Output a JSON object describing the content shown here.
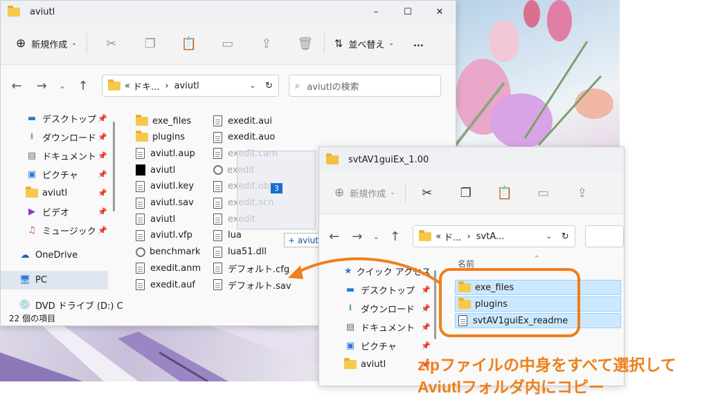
{
  "win1": {
    "title": "aviutl",
    "toolbar": {
      "new_label": "新規作成",
      "sort_label": "並べ替え",
      "more": "..."
    },
    "path": {
      "prefix": "«",
      "part1": "ドキ...",
      "sep": "›",
      "part2": "aviutl"
    },
    "search_placeholder": "aviutlの検索",
    "sidebar": [
      {
        "label": "デスクトップ",
        "icon": "desktop-icon"
      },
      {
        "label": "ダウンロード",
        "icon": "download-icon"
      },
      {
        "label": "ドキュメント",
        "icon": "document-icon"
      },
      {
        "label": "ピクチャ",
        "icon": "picture-icon"
      },
      {
        "label": "aviutl",
        "icon": "folder-icon"
      },
      {
        "label": "ビデオ",
        "icon": "video-icon"
      },
      {
        "label": "ミュージック",
        "icon": "music-icon"
      }
    ],
    "onedrive": "OneDrive",
    "pc": "PC",
    "dvd": "DVD ドライブ (D:) C",
    "status": "22 個の項目",
    "files_col1": [
      "exe_files",
      "plugins",
      "aviutl.aup",
      "aviutl",
      "aviutl.key",
      "aviutl.sav",
      "aviutl",
      "aviutl.vfp",
      "benchmark",
      "exedit.anm",
      "exedit.auf"
    ],
    "files_col2": [
      "exedit.aui",
      "exedit.auo",
      "exedit.cam",
      "exedit",
      "exedit.obj",
      "exedit.scn",
      "exedit",
      "lua",
      "lua51.dll",
      "デフォルト.cfg",
      "デフォルト.sav"
    ]
  },
  "drag": {
    "count": "3",
    "tooltip": "+ aviutl へコピー"
  },
  "win2": {
    "title": "svtAV1guiEx_1.00",
    "toolbar": {
      "new_label": "新規作成"
    },
    "path": {
      "prefix": "«",
      "part1": "ド...",
      "sep": "›",
      "part2": "svtA..."
    },
    "column_header": "名前",
    "sidebar": [
      {
        "label": "クイック アクセス",
        "icon": "star-icon"
      },
      {
        "label": "デスクトップ",
        "icon": "desktop-icon"
      },
      {
        "label": "ダウンロード",
        "icon": "download-icon"
      },
      {
        "label": "ドキュメント",
        "icon": "document-icon"
      },
      {
        "label": "ピクチャ",
        "icon": "picture-icon"
      },
      {
        "label": "aviutl",
        "icon": "folder-icon"
      }
    ],
    "files": [
      "exe_files",
      "plugins",
      "svtAV1guiEx_readme"
    ]
  },
  "annotation": {
    "line1": "zipファイルの中身をすべて選択して",
    "line2": "Aviutlフォルダ内にコピー",
    "color": "#ef7f1a"
  }
}
